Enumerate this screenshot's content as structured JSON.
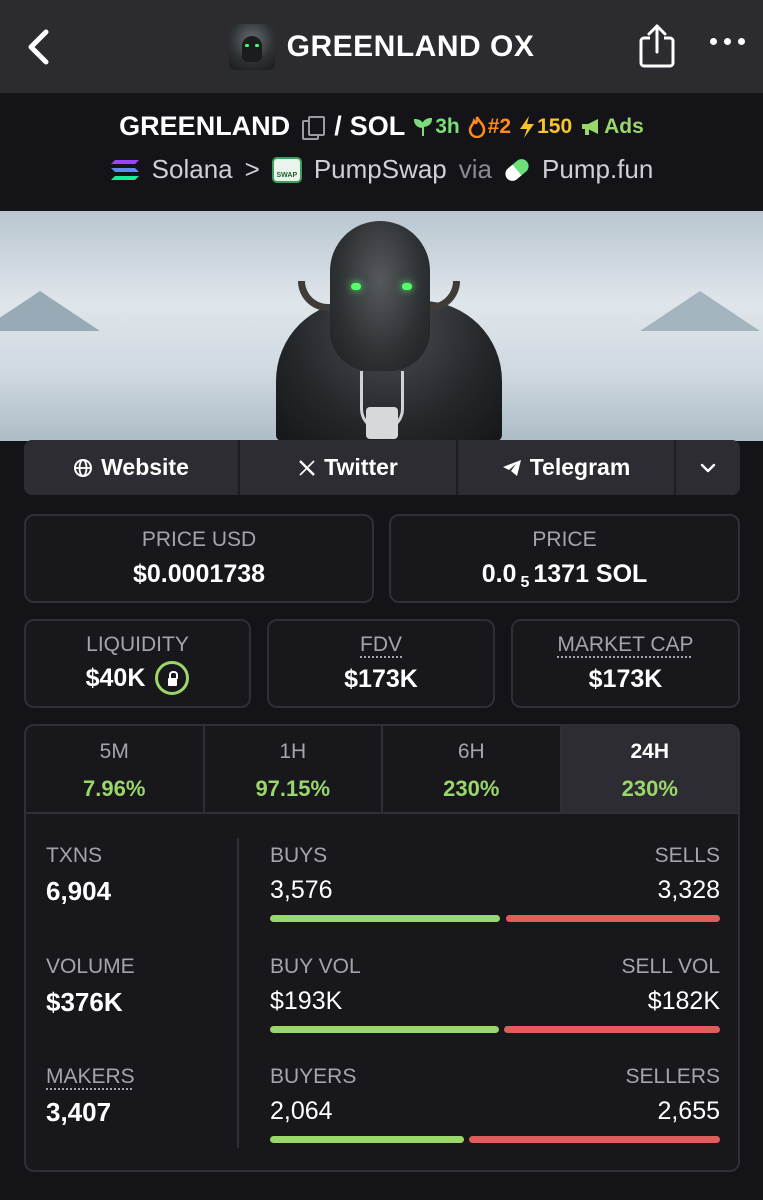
{
  "nav": {
    "title": "GREENLAND OX",
    "back_icon": "chevron-left-icon",
    "share_icon": "share-icon",
    "more_icon": "more-icon"
  },
  "pair": {
    "base": "GREENLAND",
    "separator": "/",
    "quote": "SOL",
    "age": "3h",
    "rank": "#2",
    "boosts": "150",
    "ads": "Ads"
  },
  "route": {
    "chain": "Solana",
    "arrow": ">",
    "dex": "PumpSwap",
    "via": "via",
    "launchpad": "Pump.fun"
  },
  "links": {
    "website": "Website",
    "twitter": "Twitter",
    "telegram": "Telegram"
  },
  "price": {
    "usd_label": "PRICE USD",
    "usd_value": "$0.0001738",
    "native_label": "PRICE",
    "native_prefix": "0.0",
    "native_sub": "5",
    "native_value": "1371 SOL"
  },
  "metrics": {
    "liquidity_label": "LIQUIDITY",
    "liquidity_value": "$40K",
    "fdv_label": "FDV",
    "fdv_value": "$173K",
    "mcap_label": "MARKET CAP",
    "mcap_value": "$173K"
  },
  "timeframes": [
    {
      "label": "5M",
      "change": "7.96%"
    },
    {
      "label": "1H",
      "change": "97.15%"
    },
    {
      "label": "6H",
      "change": "230%"
    },
    {
      "label": "24H",
      "change": "230%"
    }
  ],
  "stats": {
    "txns_label": "TXNS",
    "txns_value": "6,904",
    "volume_label": "VOLUME",
    "volume_value": "$376K",
    "makers_label": "MAKERS",
    "makers_value": "3,407",
    "buys_label": "BUYS",
    "buys_value": "3,576",
    "sells_label": "SELLS",
    "sells_value": "3,328",
    "buys_fraction": 0.518,
    "buyvol_label": "BUY VOL",
    "buyvol_value": "$193K",
    "sellvol_label": "SELL VOL",
    "sellvol_value": "$182K",
    "buyvol_fraction": 0.515,
    "buyers_label": "BUYERS",
    "buyers_value": "2,064",
    "sellers_label": "SELLERS",
    "sellers_value": "2,655",
    "buyers_fraction": 0.437
  },
  "colors": {
    "positive": "#9ad76a",
    "negative": "#e25c5c",
    "background": "#131318"
  }
}
